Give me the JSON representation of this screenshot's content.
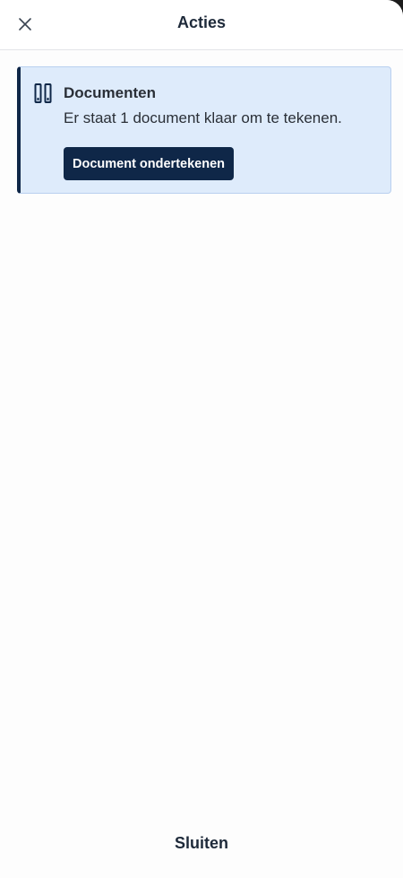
{
  "header": {
    "title": "Acties",
    "close_icon": "close-icon"
  },
  "card": {
    "icon": "documents-icon",
    "accent_color": "#0f2748",
    "background_color": "#deebfb",
    "title": "Documenten",
    "text": "Er staat 1 document klaar om te tekenen.",
    "button_label": "Document ondertekenen"
  },
  "footer": {
    "close_label": "Sluiten"
  }
}
